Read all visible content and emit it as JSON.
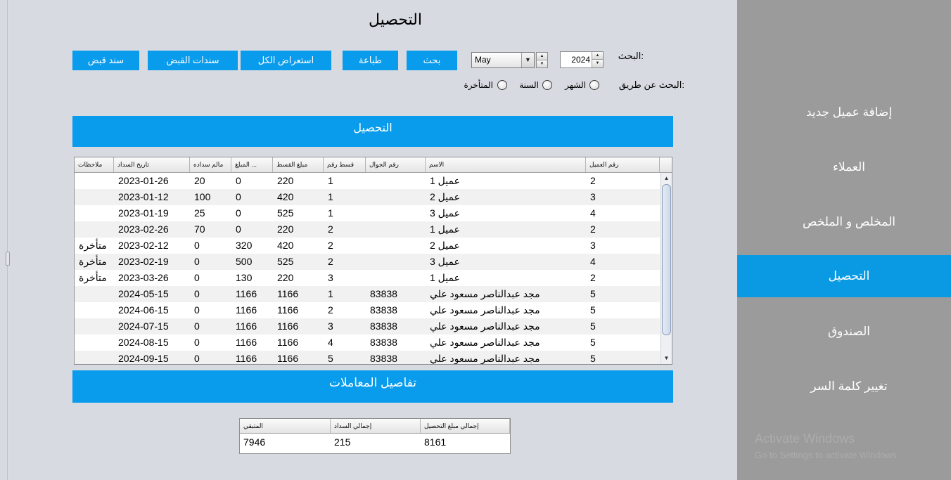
{
  "page": {
    "title": "التحصيل"
  },
  "toolbar": {
    "receipt_voucher": "سند قبض",
    "receipt_vouchers": "سندات القبض",
    "show_all": "استعراض الكل",
    "print": "طباعة",
    "search": "بحث"
  },
  "search": {
    "label": "البحث:",
    "month": "May",
    "year": "2024",
    "by_label": "البحث عن طريق:",
    "by_month": {
      "label": "الشهر",
      "checked": false
    },
    "by_year": {
      "label": "السنة",
      "checked": false
    },
    "by_overdue": {
      "label": "المتأخرة",
      "checked": false
    }
  },
  "collection_bar": {
    "title": "التحصيل"
  },
  "table": {
    "columns": [
      "رقم العميل",
      "الاسم",
      "رقم الجوال",
      "قسط رقم",
      "مبلغ القسط",
      "المبلغ ...",
      "مالم سداده",
      "تاريخ السداد",
      "ملاحظات"
    ],
    "rows": [
      [
        "2",
        "عميل 1",
        "",
        "1",
        "220",
        "0",
        "20",
        "2023-01-26",
        ""
      ],
      [
        "3",
        "عميل 2",
        "",
        "1",
        "420",
        "0",
        "100",
        "2023-01-12",
        ""
      ],
      [
        "4",
        "عميل 3",
        "",
        "1",
        "525",
        "0",
        "25",
        "2023-01-19",
        ""
      ],
      [
        "2",
        "عميل 1",
        "",
        "2",
        "220",
        "0",
        "70",
        "2023-02-26",
        ""
      ],
      [
        "3",
        "عميل 2",
        "",
        "2",
        "420",
        "320",
        "0",
        "2023-02-12",
        "متأخرة"
      ],
      [
        "4",
        "عميل 3",
        "",
        "2",
        "525",
        "500",
        "0",
        "2023-02-19",
        "متأخرة"
      ],
      [
        "2",
        "عميل 1",
        "",
        "3",
        "220",
        "130",
        "0",
        "2023-03-26",
        "متأخرة"
      ],
      [
        "5",
        "مجد عبدالناصر مسعود علي",
        "83838",
        "1",
        "1166",
        "1166",
        "0",
        "2024-05-15",
        ""
      ],
      [
        "5",
        "مجد عبدالناصر مسعود علي",
        "83838",
        "2",
        "1166",
        "1166",
        "0",
        "2024-06-15",
        ""
      ],
      [
        "5",
        "مجد عبدالناصر مسعود علي",
        "83838",
        "3",
        "1166",
        "1166",
        "0",
        "2024-07-15",
        ""
      ],
      [
        "5",
        "مجد عبدالناصر مسعود علي",
        "83838",
        "4",
        "1166",
        "1166",
        "0",
        "2024-08-15",
        ""
      ],
      [
        "5",
        "مجد عبدالناصر مسعود علي",
        "83838",
        "5",
        "1166",
        "1166",
        "0",
        "2024-09-15",
        ""
      ]
    ]
  },
  "details_bar": {
    "title": "تفاصيل المعاملات"
  },
  "summary": {
    "columns": [
      "إجمالي مبلغ التحصيل",
      "إجمالي السداد",
      "المتبقي"
    ],
    "values": [
      "8161",
      "215",
      "7946"
    ]
  },
  "sidebar": {
    "items": [
      {
        "label": "إضافة عميل جديد",
        "active": false
      },
      {
        "label": "العملاء",
        "active": false
      },
      {
        "label": "المخلص و الملخص",
        "active": false
      },
      {
        "label": "التحصيل",
        "active": true
      },
      {
        "label": "الصندوق",
        "active": false
      },
      {
        "label": "تغيير كلمة السر",
        "active": false
      }
    ]
  },
  "watermark": {
    "line1": "Activate Windows",
    "line2": "Go to Settings to activate Windows."
  },
  "colors": {
    "accent": "#0a9cec",
    "background": "#d7dae1",
    "sidebar": "#9b9b9b",
    "text_on_accent": "#ffffff"
  }
}
